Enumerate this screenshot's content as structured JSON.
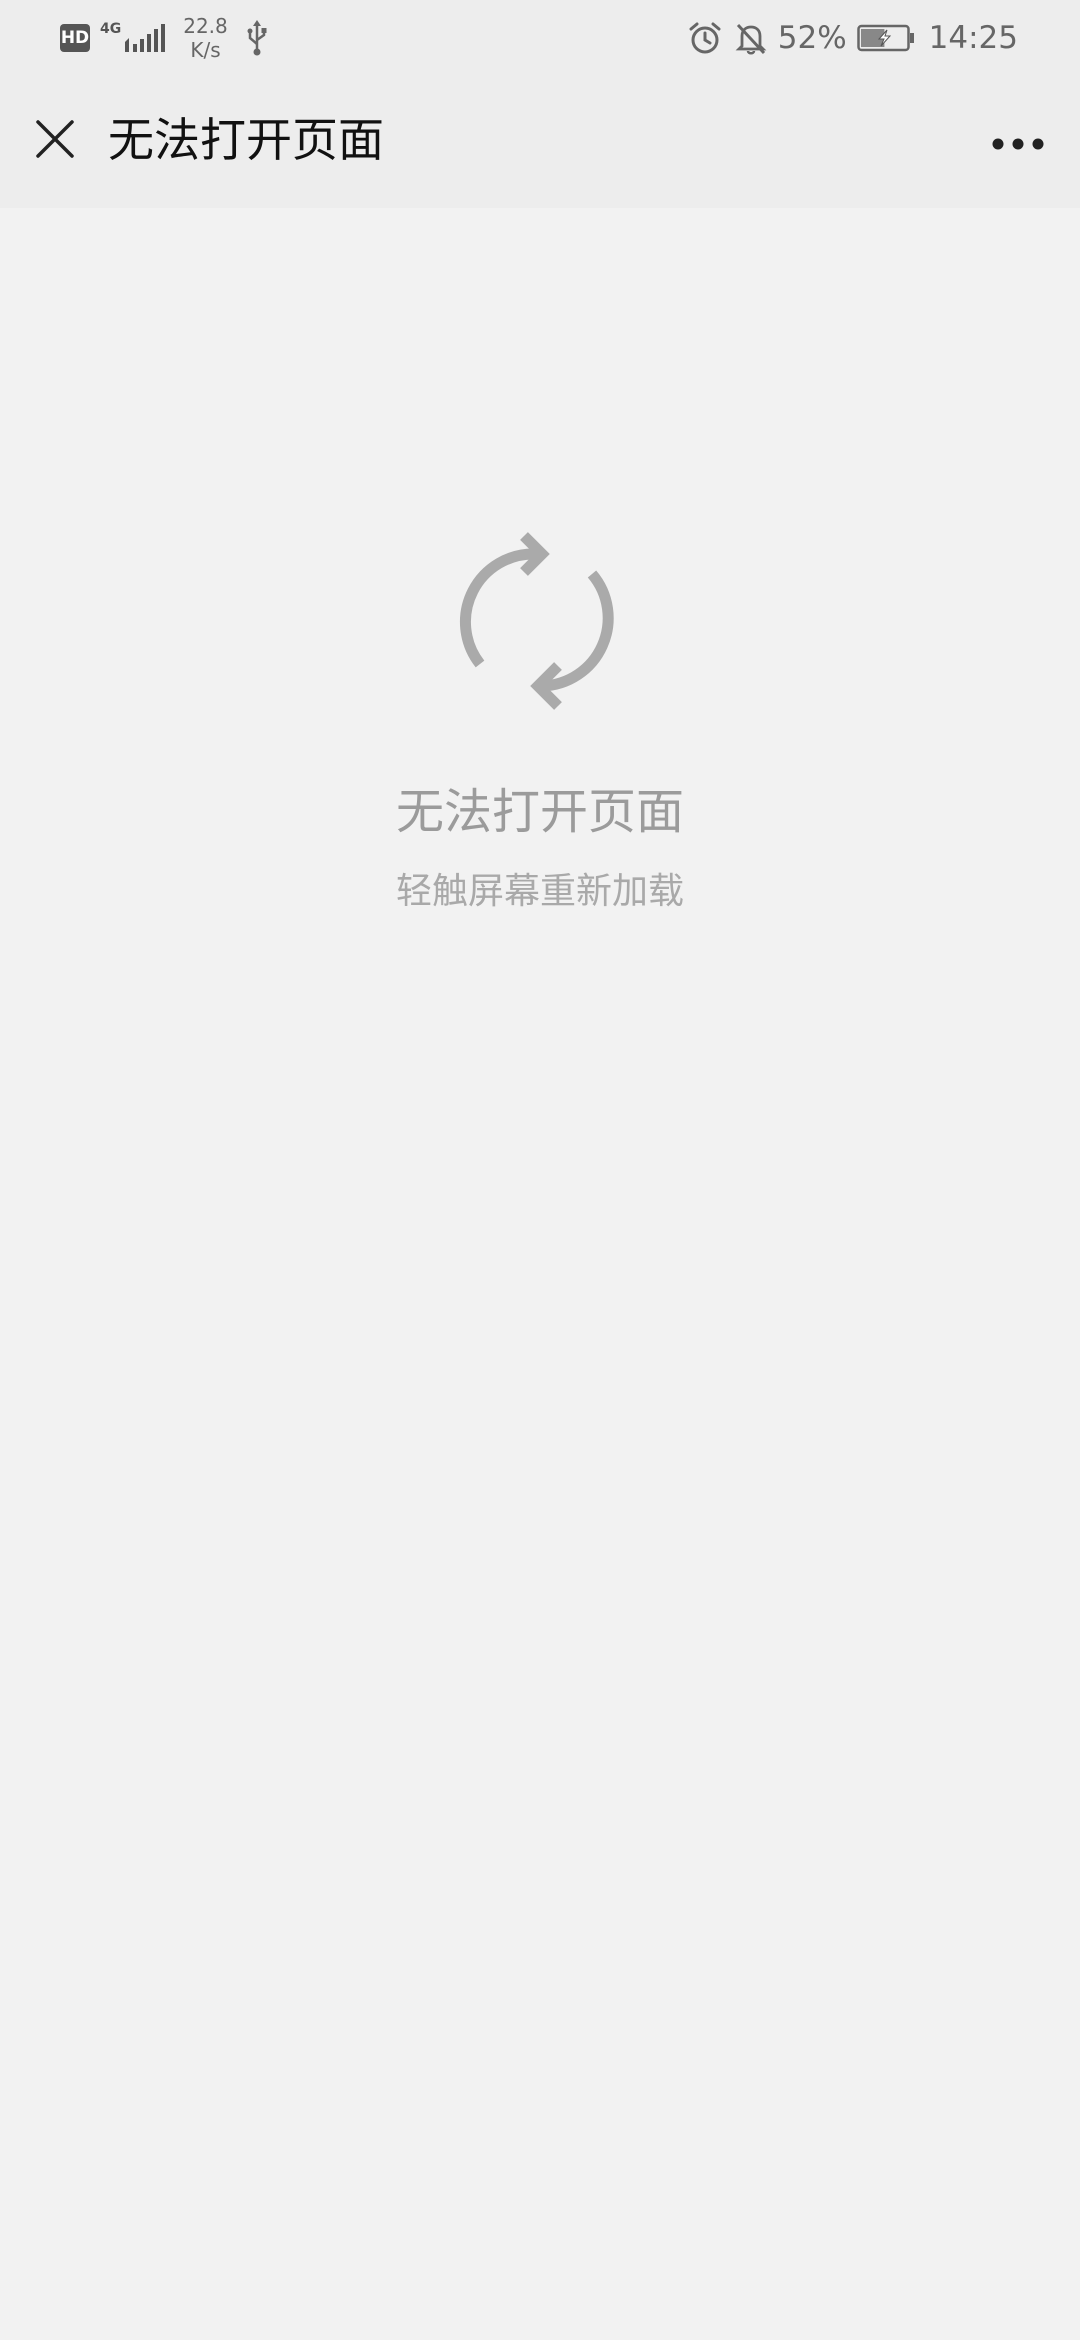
{
  "status_bar": {
    "hd_badge": "HD",
    "network_type": "4G",
    "speed_value": "22.8",
    "speed_unit": "K/s",
    "battery_percent": "52%",
    "time": "14:25",
    "icons": [
      "hd-icon",
      "signal-icon",
      "usb-icon",
      "alarm-icon",
      "bell-off-icon",
      "battery-charging-icon"
    ],
    "battery_level": 0.52
  },
  "nav": {
    "title": "无法打开页面",
    "close_icon": "close-icon",
    "more_icon": "more-icon"
  },
  "content": {
    "icon": "refresh-icon",
    "error_title": "无法打开页面",
    "error_hint": "轻触屏幕重新加载"
  }
}
